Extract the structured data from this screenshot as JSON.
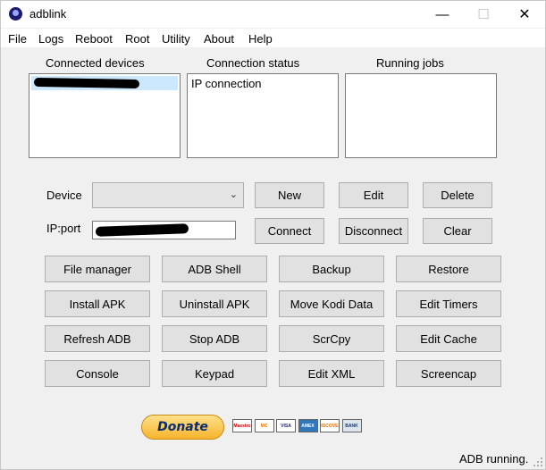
{
  "window": {
    "title": "adblink"
  },
  "menu": [
    "File",
    "Logs",
    "Reboot",
    "Root",
    "Utility",
    "About",
    "Help"
  ],
  "panels": {
    "connected_devices": {
      "label": "Connected devices"
    },
    "connection_status": {
      "label": "Connection status",
      "lines": [
        "IP connection"
      ]
    },
    "running_jobs": {
      "label": "Running jobs"
    }
  },
  "device": {
    "label": "Device",
    "value": ""
  },
  "ipport": {
    "label": "IP:port"
  },
  "device_buttons": [
    "New",
    "Edit",
    "Delete",
    "Connect",
    "Disconnect",
    "Clear"
  ],
  "action_buttons": [
    "File manager",
    "ADB Shell",
    "Backup",
    "Restore",
    "Install APK",
    "Uninstall APK",
    "Move Kodi Data",
    "Edit Timers",
    "Refresh ADB",
    "Stop ADB",
    "ScrCpy",
    "Edit Cache",
    "Console",
    "Keypad",
    "Edit XML",
    "Screencap"
  ],
  "donate": {
    "label": "Donate"
  },
  "payment_cards": [
    {
      "label": "Maestro",
      "bg": "#ffffff",
      "fg": "#cc0000"
    },
    {
      "label": "MC",
      "bg": "#ffffff",
      "fg": "#ee7700"
    },
    {
      "label": "VISA",
      "bg": "#ffffff",
      "fg": "#1a1f71"
    },
    {
      "label": "AMEX",
      "bg": "#2e77bb",
      "fg": "#ffffff"
    },
    {
      "label": "DISCOVER",
      "bg": "#ffffff",
      "fg": "#e07000"
    },
    {
      "label": "BANK",
      "bg": "#dde6ef",
      "fg": "#1a3a6a"
    }
  ],
  "status": {
    "text": "ADB running."
  },
  "colors": {
    "selection": "#cce8ff",
    "button_face": "#e1e1e1",
    "window_bg": "#f0f0f0"
  }
}
